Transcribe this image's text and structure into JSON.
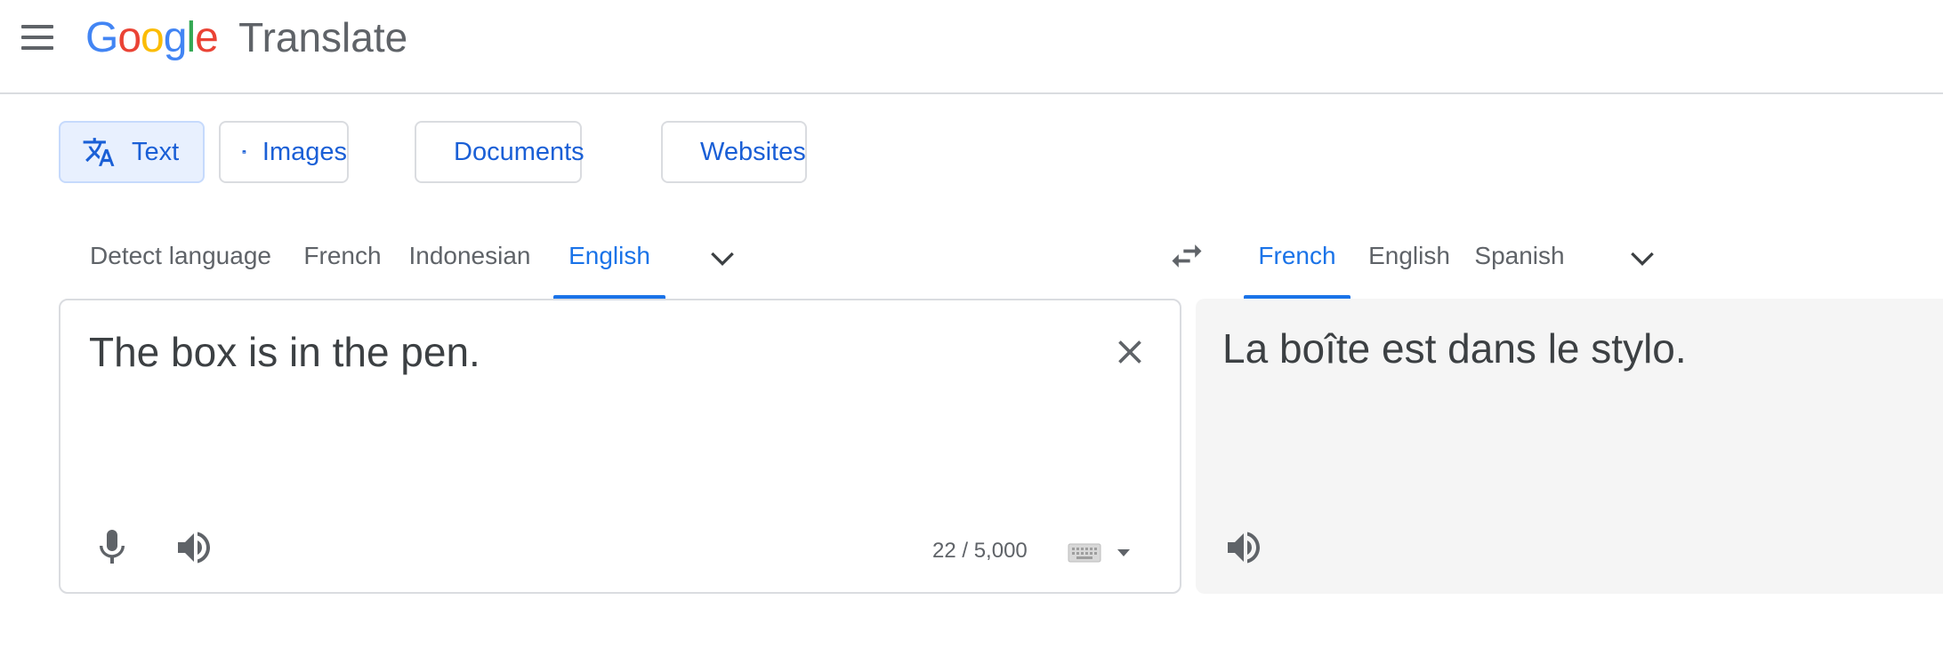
{
  "header": {
    "logo_letters": [
      {
        "char": "G",
        "color": "#4285F4"
      },
      {
        "char": "o",
        "color": "#EA4335"
      },
      {
        "char": "o",
        "color": "#FBBC05"
      },
      {
        "char": "g",
        "color": "#4285F4"
      },
      {
        "char": "l",
        "color": "#34A853"
      },
      {
        "char": "e",
        "color": "#EA4335"
      }
    ],
    "product_name": "Translate",
    "menu_icon": "hamburger-menu-icon"
  },
  "mode_tabs": [
    {
      "label": "Text",
      "icon": "translate-icon",
      "active": true
    },
    {
      "label": "Images",
      "icon": "image-icon",
      "active": false
    },
    {
      "label": "Documents",
      "icon": "document-icon",
      "active": false
    },
    {
      "label": "Websites",
      "icon": "website-icon",
      "active": false
    }
  ],
  "source_languages": [
    {
      "label": "Detect language",
      "active": false
    },
    {
      "label": "French",
      "active": false
    },
    {
      "label": "Indonesian",
      "active": false
    },
    {
      "label": "English",
      "active": true
    }
  ],
  "target_languages": [
    {
      "label": "French",
      "active": true
    },
    {
      "label": "English",
      "active": false
    },
    {
      "label": "Spanish",
      "active": false
    }
  ],
  "source": {
    "text": "The box is in the pen.",
    "char_count": "22 / 5,000"
  },
  "target": {
    "text": "La boîte est dans le stylo."
  },
  "colors": {
    "accent": "#1a73e8",
    "active_tab_bg": "#e8f0fe",
    "target_panel_bg": "#f5f5f5"
  }
}
